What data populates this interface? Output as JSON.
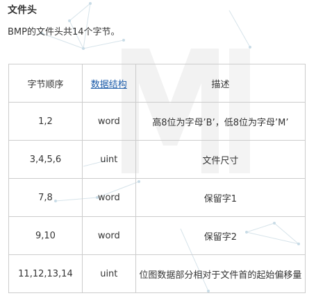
{
  "section": {
    "title": "文件头",
    "description": "BMP的文件头共14个字节。"
  },
  "table": {
    "headers": [
      "字节顺序",
      "数据结构",
      "描述"
    ],
    "rows": [
      [
        "1,2",
        "word",
        "高8位为字母’B’，低8位为字母’M’"
      ],
      [
        "3,4,5,6",
        "uint",
        "文件尺寸"
      ],
      [
        "7,8",
        "word",
        "保留字1"
      ],
      [
        "9,10",
        "word",
        "保留字2"
      ],
      [
        "11,12,13,14",
        "uint",
        "位图数据部分相对于文件首的起始偏移量"
      ]
    ]
  }
}
